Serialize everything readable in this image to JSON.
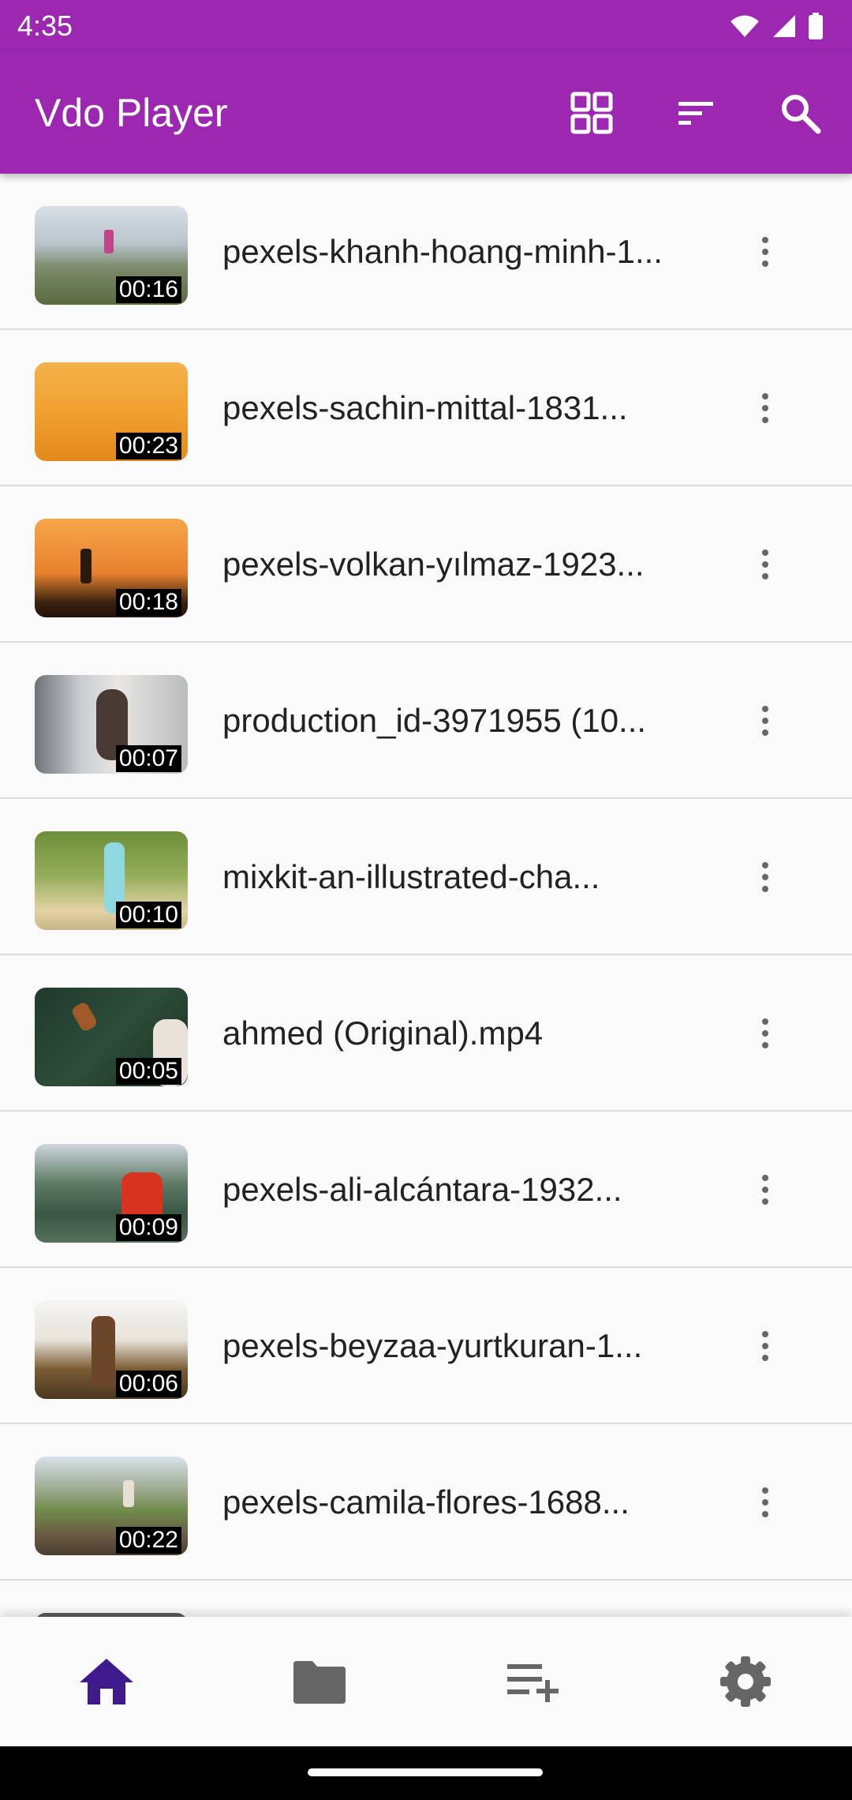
{
  "status_bar": {
    "time": "4:35",
    "icons": [
      "wifi-icon",
      "signal-icon",
      "battery-icon"
    ]
  },
  "app_bar": {
    "title": "Vdo Player",
    "actions": [
      "grid-view-icon",
      "sort-icon",
      "search-icon"
    ],
    "color": "#9c27b0"
  },
  "videos": [
    {
      "title": "pexels-khanh-hoang-minh-1...",
      "duration": "00:16"
    },
    {
      "title": "pexels-sachin-mittal-1831...",
      "duration": "00:23"
    },
    {
      "title": "pexels-volkan-yılmaz-1923...",
      "duration": "00:18"
    },
    {
      "title": "production_id-3971955 (10...",
      "duration": "00:07"
    },
    {
      "title": "mixkit-an-illustrated-cha...",
      "duration": "00:10"
    },
    {
      "title": "ahmed (Original).mp4",
      "duration": "00:05"
    },
    {
      "title": "pexels-ali-alcántara-1932...",
      "duration": "00:09"
    },
    {
      "title": "pexels-beyzaa-yurtkuran-1...",
      "duration": "00:06"
    },
    {
      "title": "pexels-camila-flores-1688...",
      "duration": "00:22"
    }
  ],
  "bottom_nav": {
    "items": [
      "home-icon",
      "folder-icon",
      "playlist-add-icon",
      "settings-icon"
    ],
    "active_color": "#3f1a8c",
    "inactive_color": "#666666"
  }
}
